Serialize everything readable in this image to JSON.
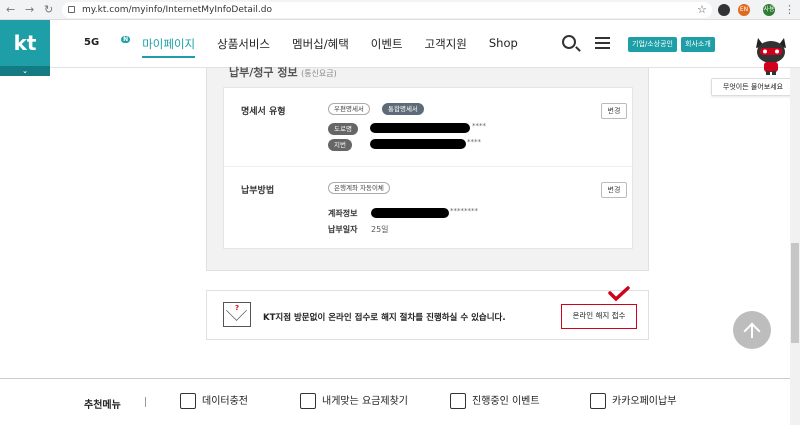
{
  "browser": {
    "url": "my.kt.com/myinfo/InternetMyInfoDetail.do",
    "ext_label_1": "EN",
    "ext_label_2": "사용"
  },
  "gnb": {
    "logo": "kt",
    "menu_5g": "5G",
    "menu_5g_badge": "N",
    "menu": [
      "마이페이지",
      "상품서비스",
      "멤버십/혜택",
      "이벤트",
      "고객지원",
      "Shop"
    ],
    "biz_button": "기업/소상공인",
    "about_button": "회사소개"
  },
  "chatbot": {
    "bubble": "무엇이든 물어보세요"
  },
  "billing": {
    "section_title": "납부/청구 정보",
    "section_title_suffix": "(통신요금)",
    "bill_type_label": "명세서 유형",
    "bill_type_options": [
      "우편명세서",
      "통합명세서"
    ],
    "address_tag_road": "도로명",
    "address_tag_lot": "지번",
    "masked_suffix": "****",
    "edit_label": "변경",
    "pay_method_label": "납부방법",
    "pay_method_chip": "은행계좌 자동이체",
    "account_label": "계좌정보",
    "account_mask": "********",
    "pay_day_label": "납부일자",
    "pay_day_value": "25일"
  },
  "notice": {
    "text": "KT지점 방문없이 온라인 접수로 해지 절차를 진행하실 수 있습니다.",
    "button": "온라인 해지 접수"
  },
  "footer": {
    "title": "추천메뉴",
    "items": [
      "데이터충전",
      "내게맞는 요금제찾기",
      "진행중인 이벤트",
      "카카오페이납부"
    ]
  },
  "colors": {
    "accent": "#1e9fa7",
    "highlight": "#d0021b"
  }
}
